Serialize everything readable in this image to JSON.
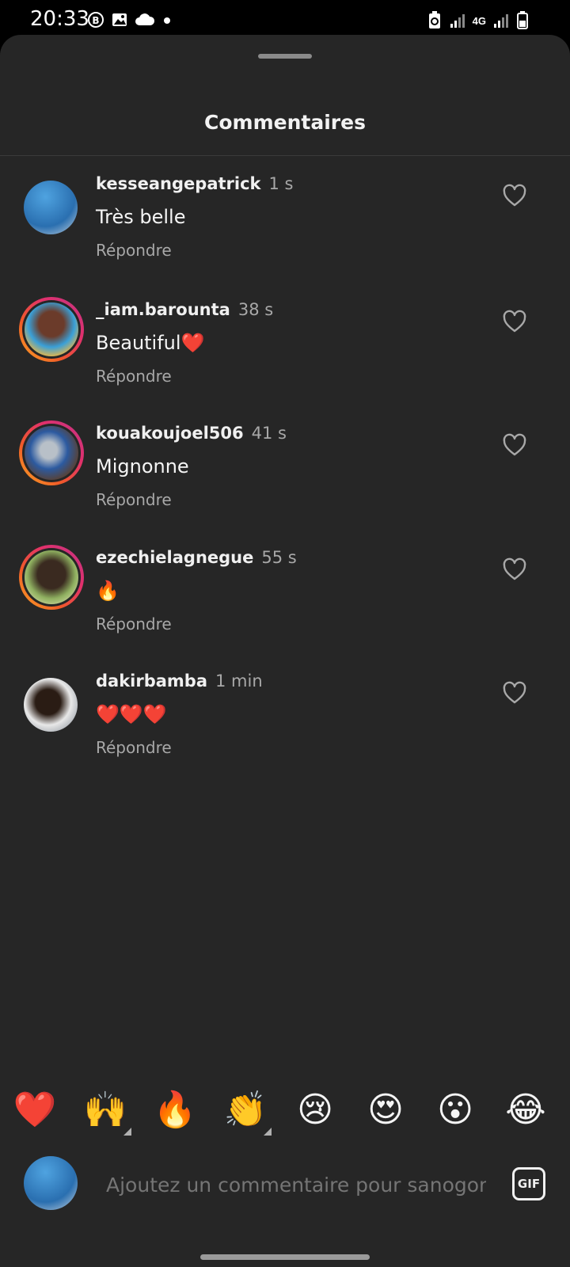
{
  "status_bar": {
    "time": "20:33",
    "network": "4G",
    "icons": [
      "b-badge-icon",
      "gallery-icon",
      "cloud-icon",
      "dot-icon",
      "recycle-battery-icon",
      "signal-icon",
      "signal-icon",
      "battery-icon"
    ]
  },
  "sheet": {
    "title": "Commentaires"
  },
  "comments": [
    {
      "username": "kesseangepatrick",
      "time": "1 s",
      "text": "Très belle",
      "reply": "Répondre",
      "story_ring": false
    },
    {
      "username": "_iam.barounta",
      "time": "38 s",
      "text": "Beautiful❤️",
      "reply": "Répondre",
      "story_ring": true
    },
    {
      "username": "kouakoujoel506",
      "time": "41 s",
      "text": "Mignonne",
      "reply": "Répondre",
      "story_ring": true
    },
    {
      "username": "ezechielagnegue",
      "time": "55 s",
      "text": "🔥",
      "reply": "Répondre",
      "story_ring": true
    },
    {
      "username": "dakirbamba",
      "time": "1 min",
      "text": "❤️❤️❤️",
      "reply": "Répondre",
      "story_ring": false
    }
  ],
  "quick_reactions": [
    "❤️",
    "🙌",
    "🔥",
    "👏",
    "😢",
    "😍",
    "😮",
    "😂"
  ],
  "composer": {
    "placeholder": "Ajoutez un commentaire pour sanogomou",
    "gif_label": "GIF"
  },
  "colors": {
    "background": "#262626",
    "secondary_text": "#a8a8a8",
    "story_ring_start": "#f9a825",
    "story_ring_end": "#c13584"
  }
}
